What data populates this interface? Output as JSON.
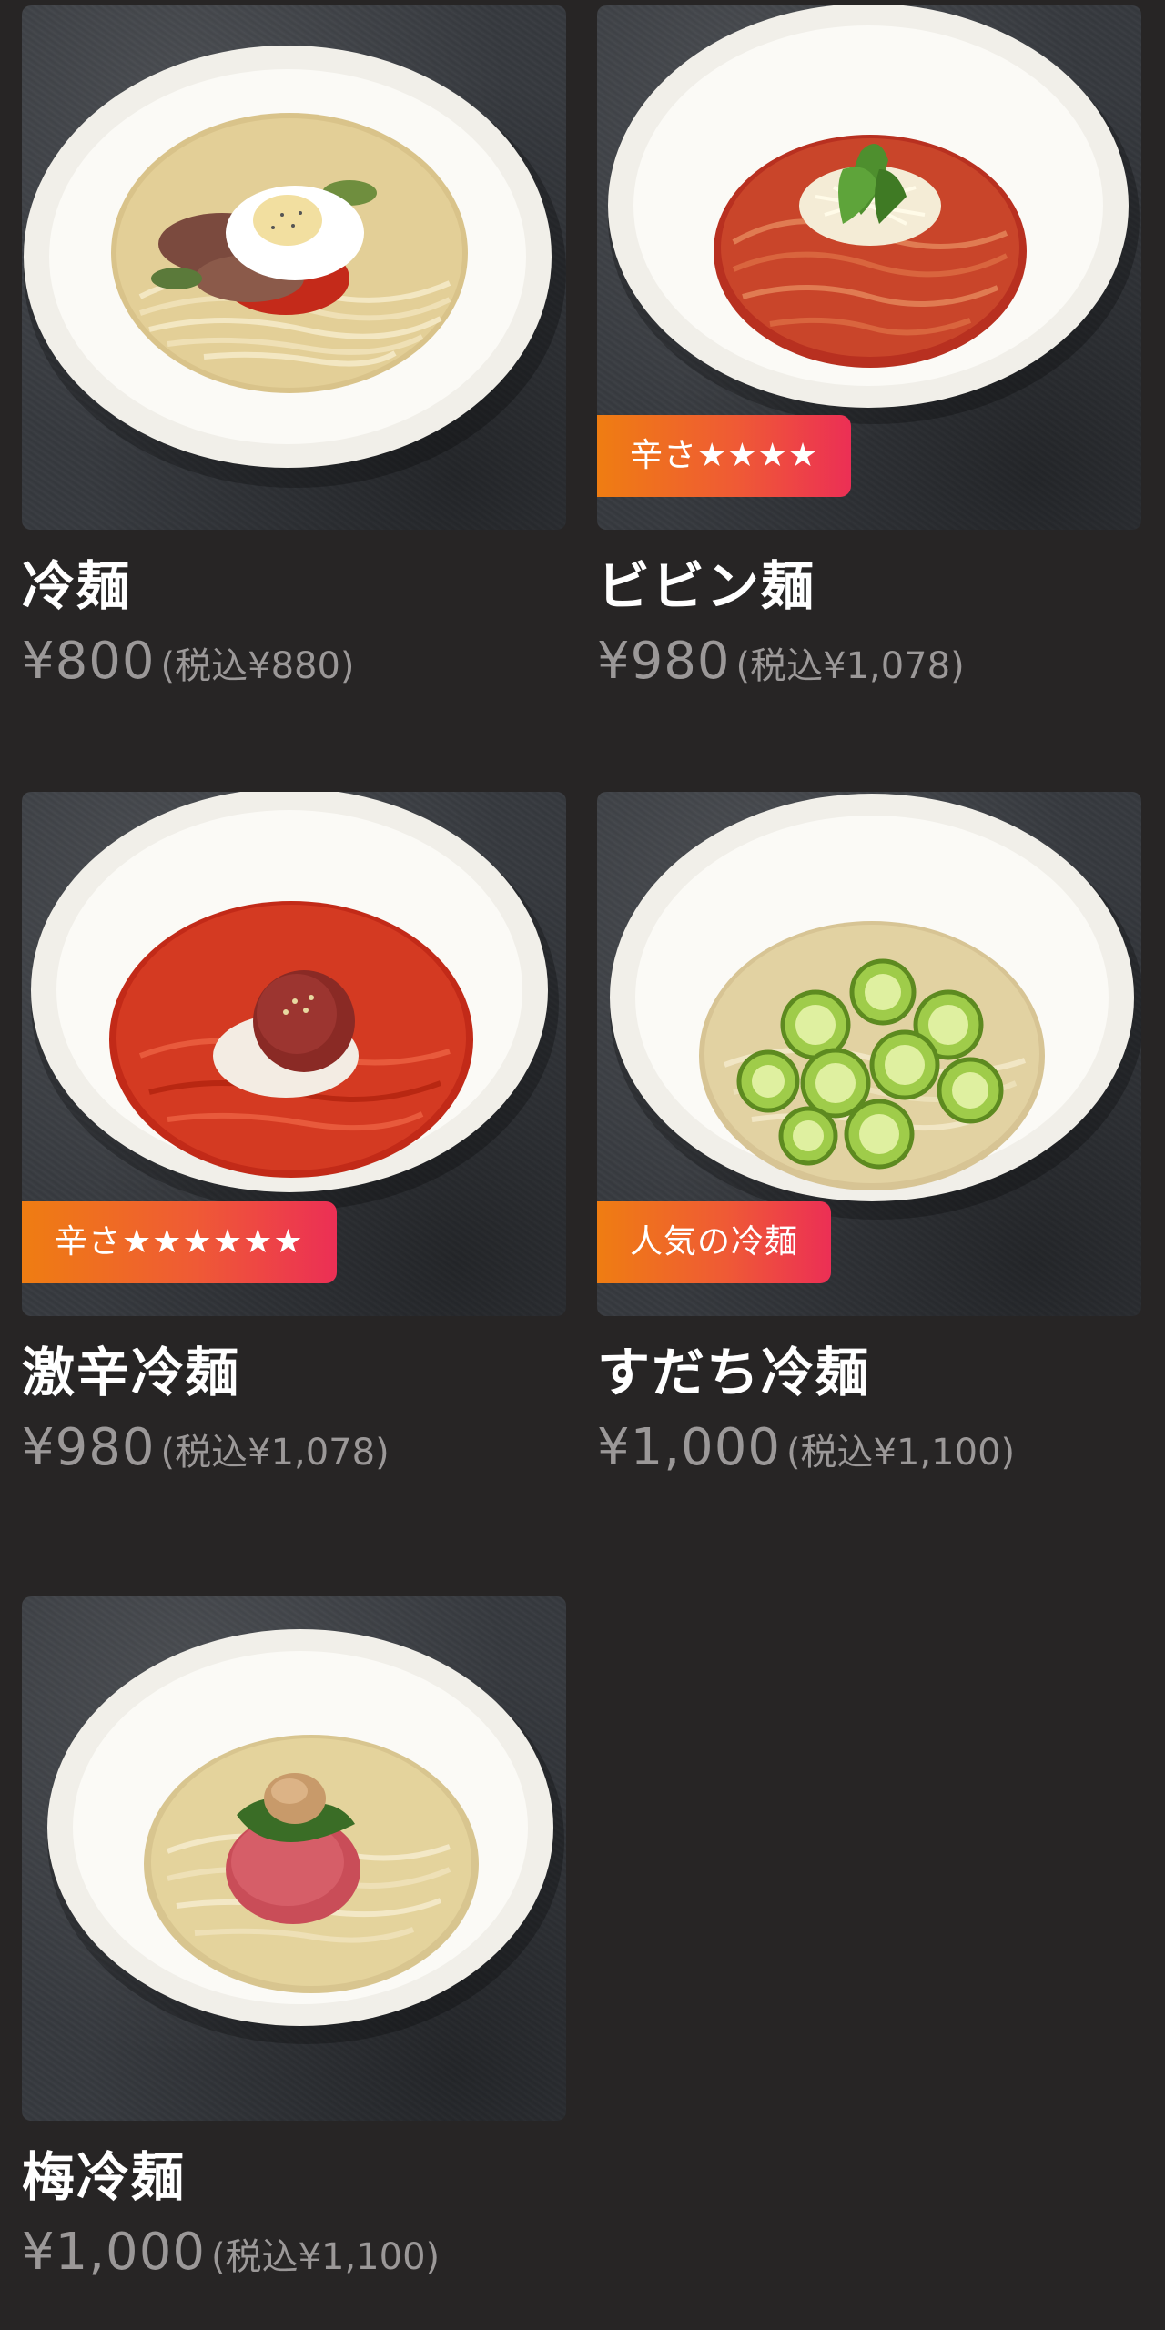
{
  "items": [
    {
      "name": "冷麺",
      "price": "¥800",
      "tax_price": "(税込¥880)",
      "badge": "",
      "dish": "cold-noodle-with-egg"
    },
    {
      "name": "ビビン麺",
      "price": "¥980",
      "tax_price": "(税込¥1,078)",
      "badge": "辛さ★★★★",
      "dish": "bibim-noodle"
    },
    {
      "name": "激辛冷麺",
      "price": "¥980",
      "tax_price": "(税込¥1,078)",
      "badge": "辛さ★★★★★★",
      "dish": "extra-spicy-noodle"
    },
    {
      "name": "すだち冷麺",
      "price": "¥1,000",
      "tax_price": "(税込¥1,100)",
      "badge": "人気の冷麺",
      "dish": "sudachi-noodle"
    },
    {
      "name": "梅冷麺",
      "price": "¥1,000",
      "tax_price": "(税込¥1,100)",
      "badge": "",
      "dish": "ume-noodle"
    }
  ],
  "colors": {
    "background": "#272525",
    "price_text": "#9b9898",
    "badge_gradient_start": "#ef7d12",
    "badge_gradient_end": "#ec2f55"
  }
}
